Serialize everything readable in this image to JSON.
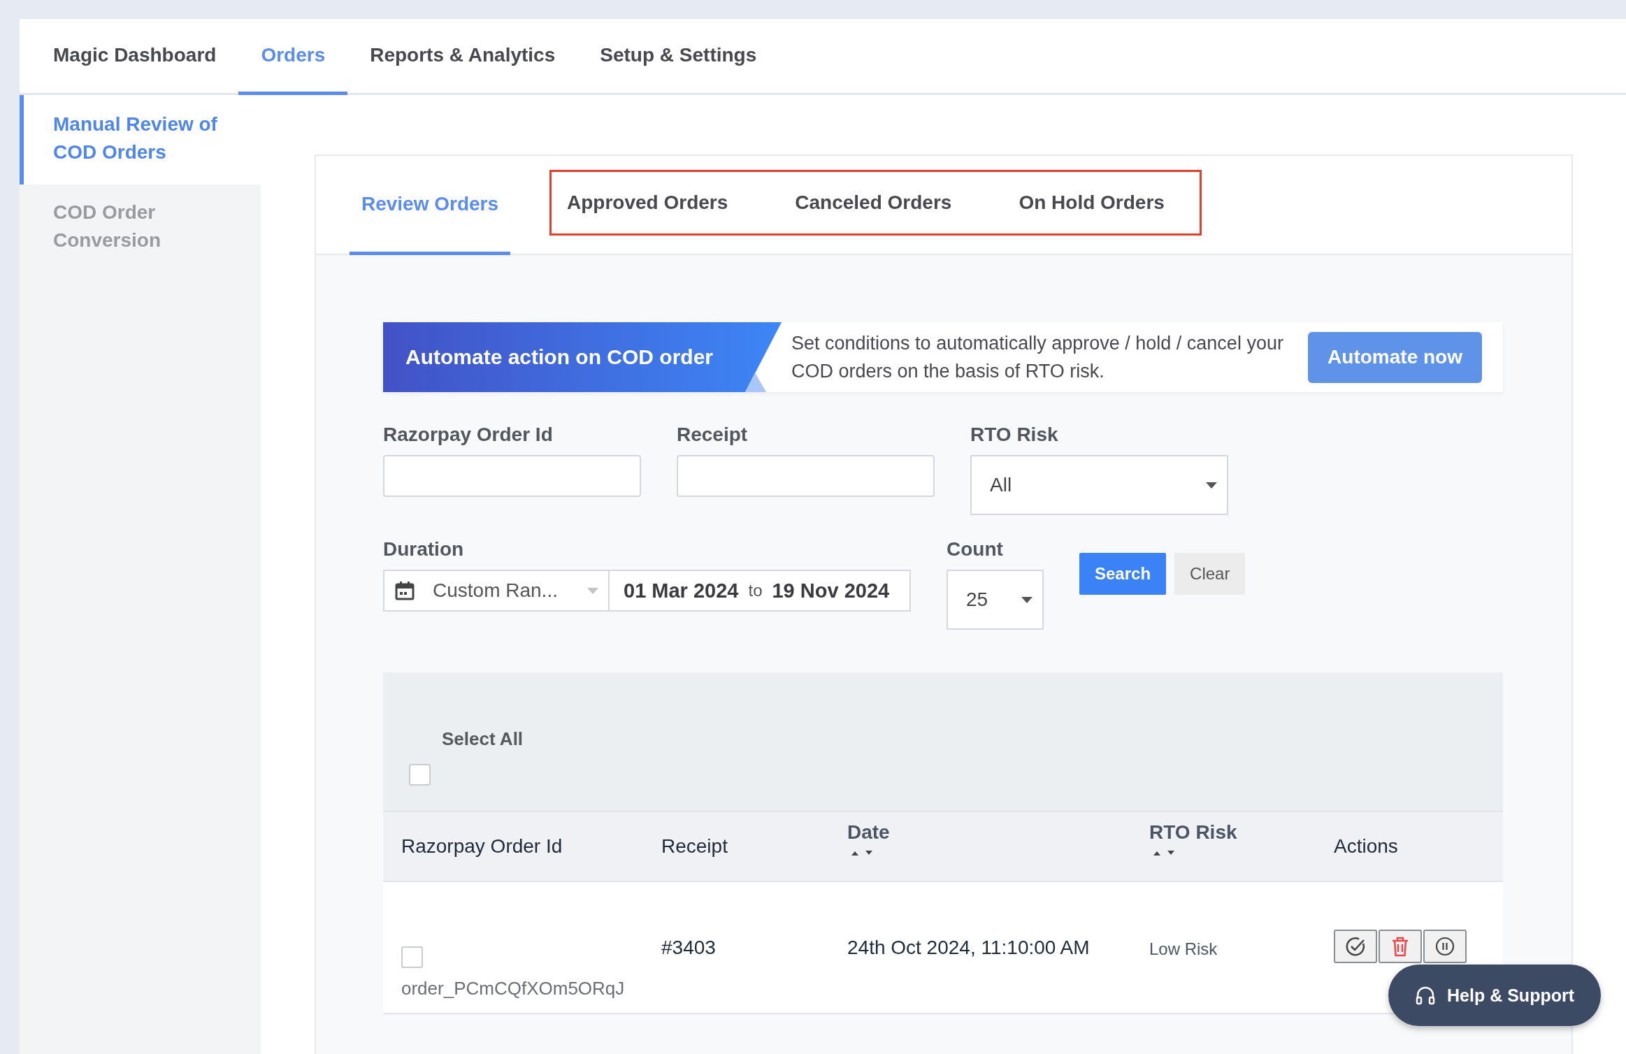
{
  "top_nav": [
    {
      "label": "Magic Dashboard",
      "selected": false
    },
    {
      "label": "Orders",
      "selected": true
    },
    {
      "label": "Reports & Analytics",
      "selected": false
    },
    {
      "label": "Setup & Settings",
      "selected": false
    }
  ],
  "sidebar": {
    "items": [
      {
        "label": "Manual Review of COD Orders",
        "selected": true
      },
      {
        "label": "COD Order Conversion",
        "selected": false
      }
    ]
  },
  "tabs": [
    {
      "label": "Review Orders",
      "selected": true,
      "highlighted": false
    },
    {
      "label": "Approved Orders",
      "selected": false,
      "highlighted": true
    },
    {
      "label": "Canceled Orders",
      "selected": false,
      "highlighted": true
    },
    {
      "label": "On Hold Orders",
      "selected": false,
      "highlighted": true
    }
  ],
  "banner": {
    "title": "Automate action on COD order",
    "text": "Set conditions to automatically approve / hold / cancel your COD orders on the basis of RTO risk.",
    "button": "Automate now"
  },
  "filters": {
    "order_id": {
      "label": "Razorpay Order Id"
    },
    "receipt": {
      "label": "Receipt"
    },
    "rto_risk": {
      "label": "RTO Risk",
      "value": "All"
    },
    "duration": {
      "label": "Duration",
      "range": "Custom Ran...",
      "from": "01 Mar 2024",
      "to_word": "to",
      "to": "19 Nov 2024"
    },
    "count": {
      "label": "Count",
      "value": "25"
    },
    "buttons": [
      "Search",
      "Clear"
    ]
  },
  "table": {
    "select_all": {
      "label": "Select All",
      "checked": false
    },
    "columns": [
      {
        "label": "Razorpay Order Id",
        "sortable": false
      },
      {
        "label": "Receipt",
        "sortable": false
      },
      {
        "label": "Date",
        "sortable": true
      },
      {
        "label": "RTO Risk",
        "sortable": true
      },
      {
        "label": "Actions",
        "sortable": false
      }
    ],
    "rows": [
      {
        "checked": false,
        "order_id": "order_PCmCQfXOm5ORqJ",
        "receipt": "#3403",
        "date": "24th Oct 2024, 11:10:00 AM",
        "rto_risk": "Low Risk"
      }
    ]
  },
  "help": {
    "label": "Help & Support"
  }
}
